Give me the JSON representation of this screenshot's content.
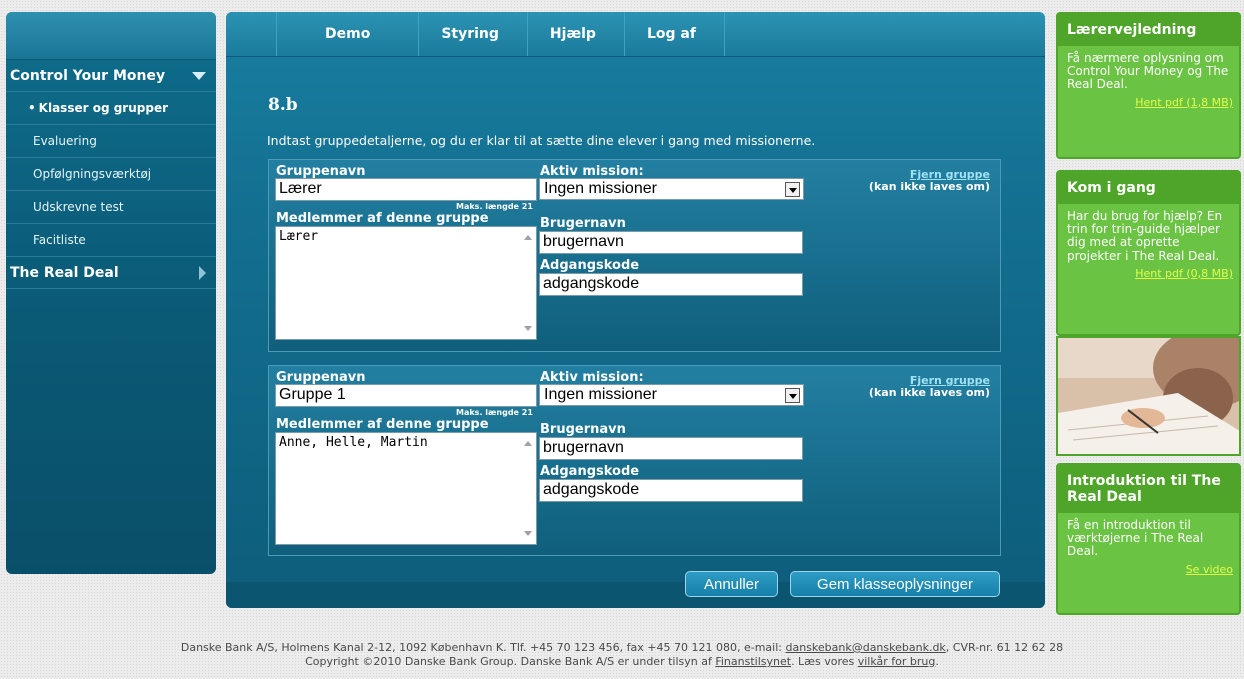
{
  "sidebar": {
    "section1": "Control Your Money",
    "items": [
      {
        "label": "Klasser og grupper"
      },
      {
        "label": "Evaluering"
      },
      {
        "label": "Opfølgningsværktøj"
      },
      {
        "label": "Udskrevne test"
      },
      {
        "label": "Facitliste"
      }
    ],
    "section2": "The Real Deal"
  },
  "nav": {
    "items": [
      "Demo",
      "Styring",
      "Hjælp",
      "Log af"
    ]
  },
  "page": {
    "title": "8.b",
    "intro": "Indtast gruppedetaljerne, og du er klar til at sætte dine elever i gang med missionerne."
  },
  "labels": {
    "group_name": "Gruppenavn",
    "active_mission": "Aktiv mission:",
    "remove_group": "Fjern gruppe",
    "remove_note": "(kan ikke laves om)",
    "max_length": "Maks. længde 21",
    "members": "Medlemmer af denne gruppe",
    "username": "Brugernavn",
    "password": "Adgangskode"
  },
  "groups": [
    {
      "name": "Lærer",
      "mission": "Ingen missioner",
      "members": "Lærer",
      "username": "brugernavn",
      "password": "adgangskode"
    },
    {
      "name": "Gruppe 1",
      "mission": "Ingen missioner",
      "members": "Anne, Helle, Martin",
      "username": "brugernavn",
      "password": "adgangskode"
    }
  ],
  "buttons": {
    "cancel": "Annuller",
    "save": "Gem klasseoplysninger"
  },
  "right": [
    {
      "title": "Lærervejledning",
      "text": "Få nærmere oplysning om Control Your Money og The Real Deal.",
      "link": "Hent pdf (1,8 MB)"
    },
    {
      "title": "Kom i gang",
      "text": "Har du brug for hjælp? En trin for trin-guide hjælper dig med at oprette projekter i The Real Deal.",
      "link": "Hent pdf (0,8 MB)"
    },
    {
      "title": "Introduktion til The Real Deal",
      "text": "Få en introduktion til værktøjerne i The Real Deal.",
      "link": "Se video"
    }
  ],
  "footer": {
    "line1_a": "Danske Bank A/S, Holmens Kanal 2-12, 1092 København K. Tlf. +45 70 123 456, fax +45 70 121 080, e-mail: ",
    "email": "danskebank@danskebank.dk",
    "line1_b": ", CVR-nr. 61 12 62 28",
    "line2_a": "Copyright ©2010 Danske Bank Group. Danske Bank A/S er under tilsyn af ",
    "finanstilsynet": "Finanstilsynet",
    "line2_b": ". Læs vores ",
    "terms": "vilkår for brug",
    "line2_c": "."
  },
  "colors": {
    "panel": "#136f90",
    "green": "#6bc343",
    "green_dark": "#4ea52a",
    "link_yellow": "#e2ff4b"
  }
}
